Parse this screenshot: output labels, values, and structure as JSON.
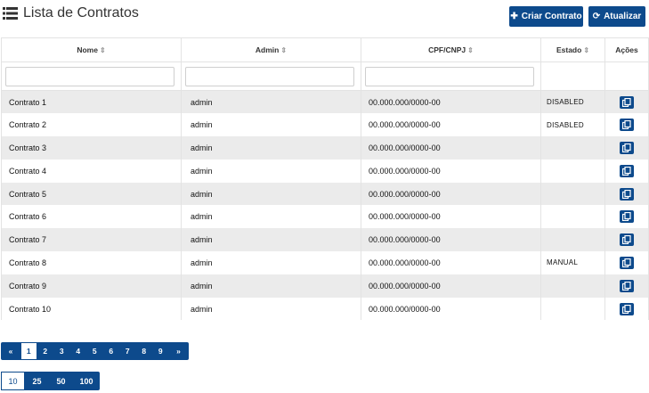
{
  "header": {
    "title": "Lista de Contratos",
    "create_label": "Criar Contrato",
    "refresh_label": "Atualizar"
  },
  "table": {
    "columns": [
      "Nome",
      "Admin",
      "CPF/CNPJ",
      "Estado",
      "Ações"
    ],
    "rows": [
      {
        "nome": "Contrato 1",
        "admin": "admin",
        "cpf": "00.000.000/0000-00",
        "estado": "DISABLED"
      },
      {
        "nome": "Contrato 2",
        "admin": "admin",
        "cpf": "00.000.000/0000-00",
        "estado": "DISABLED"
      },
      {
        "nome": "Contrato 3",
        "admin": "admin",
        "cpf": "00.000.000/0000-00",
        "estado": ""
      },
      {
        "nome": "Contrato 4",
        "admin": "admin",
        "cpf": "00.000.000/0000-00",
        "estado": ""
      },
      {
        "nome": "Contrato 5",
        "admin": "admin",
        "cpf": "00.000.000/0000-00",
        "estado": ""
      },
      {
        "nome": "Contrato 6",
        "admin": "admin",
        "cpf": "00.000.000/0000-00",
        "estado": ""
      },
      {
        "nome": "Contrato 7",
        "admin": "admin",
        "cpf": "00.000.000/0000-00",
        "estado": ""
      },
      {
        "nome": "Contrato 8",
        "admin": "admin",
        "cpf": "00.000.000/0000-00",
        "estado": "MANUAL"
      },
      {
        "nome": "Contrato 9",
        "admin": "admin",
        "cpf": "00.000.000/0000-00",
        "estado": ""
      },
      {
        "nome": "Contrato 10",
        "admin": "admin",
        "cpf": "00.000.000/0000-00",
        "estado": ""
      }
    ]
  },
  "pagination": {
    "prev": "«",
    "pages": [
      "1",
      "2",
      "3",
      "4",
      "5",
      "6",
      "7",
      "8",
      "9"
    ],
    "next": "»",
    "current_page": "1"
  },
  "page_sizes": {
    "options": [
      "10",
      "25",
      "50",
      "100"
    ],
    "selected": "10"
  },
  "colors": {
    "primary": "#0d4a8c",
    "row_alt": "#ebebeb"
  },
  "icons": {
    "title": "list-icon",
    "create": "plus-icon",
    "refresh": "refresh-icon",
    "row_action": "copy-icon"
  }
}
